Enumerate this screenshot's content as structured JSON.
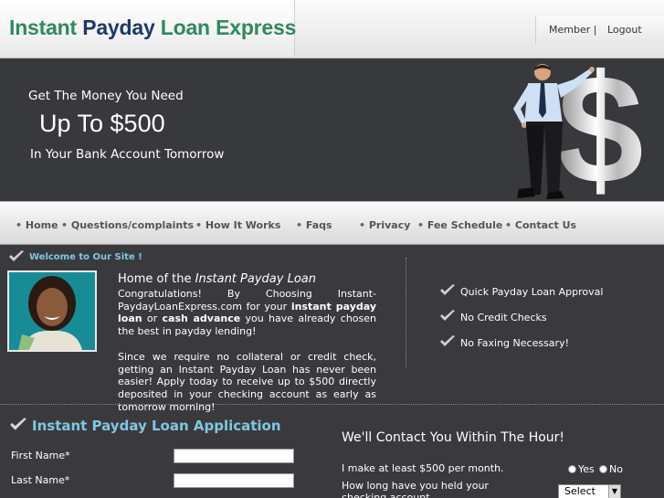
{
  "header": {
    "logo_part1": "Instant",
    "logo_part2": "Payday",
    "logo_part3": "Loan Express",
    "member_label": "Member |",
    "logout_label": "Logout"
  },
  "banner": {
    "line1": "Get The Money You  Need",
    "line2": "Up To $500",
    "line3": "In Your Bank Account Tomorrow",
    "dollar_sign": "$"
  },
  "nav": {
    "items": [
      {
        "label": "Home"
      },
      {
        "label": "Questions/complaints"
      },
      {
        "label": "How It Works"
      },
      {
        "label": "Faqs"
      },
      {
        "label": "Privacy"
      },
      {
        "label": "Fee Schedule"
      },
      {
        "label": "Contact Us"
      }
    ],
    "bullet": "•"
  },
  "welcome": {
    "label": "Welcome to Our Site !"
  },
  "intro": {
    "heading_prefix": "Home of the ",
    "heading_em": "Instant Payday Loan",
    "p1_a": "Congratulations! By Choosing Instant-PaydayLoanExpress.com for your ",
    "p1_b": "instant payday loan",
    "p1_c": " or ",
    "p1_d": "cash advance",
    "p1_e": " you have already chosen the best in payday lending!",
    "p2": "Since we require no collateral or credit check, getting an Instant Payday Loan has never been easier! Apply today to receive up to $500 directly deposited in your checking account as early as tomorrow morning!"
  },
  "features": [
    {
      "label": "Quick Payday Loan Approval"
    },
    {
      "label": "No Credit Checks"
    },
    {
      "label": "No Faxing Necessary!"
    }
  ],
  "application": {
    "title": "Instant Payday Loan Application",
    "first_name_label": "First Name*",
    "last_name_label": "Last Name*",
    "first_name_value": "",
    "last_name_value": "",
    "contact_title": "We'll Contact You Within The Hour!",
    "q_income": "I make at least $500 per month.",
    "yes_label": "Yes",
    "no_label": "No",
    "q_account": "How long have you held your checking account",
    "select_value": "Select"
  },
  "colors": {
    "brand_green": "#2f8a5e",
    "brand_navy": "#1b3a6b",
    "accent_blue": "#7fc8e0",
    "dark_bg": "#3a3a3e"
  }
}
